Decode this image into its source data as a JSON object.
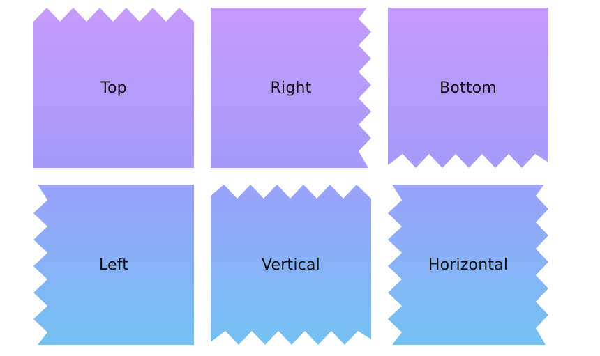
{
  "tiles": [
    {
      "label": "Top"
    },
    {
      "label": "Right"
    },
    {
      "label": "Bottom"
    },
    {
      "label": "Left"
    },
    {
      "label": "Vertical"
    },
    {
      "label": "Horizontal"
    }
  ],
  "colors": {
    "row1_top": "#c69bfa",
    "row1_bottom": "#a59bfa",
    "row2_top": "#9aa2fb",
    "row2_bottom": "#74c1f2",
    "label": "#111111",
    "background": "#ffffff"
  }
}
